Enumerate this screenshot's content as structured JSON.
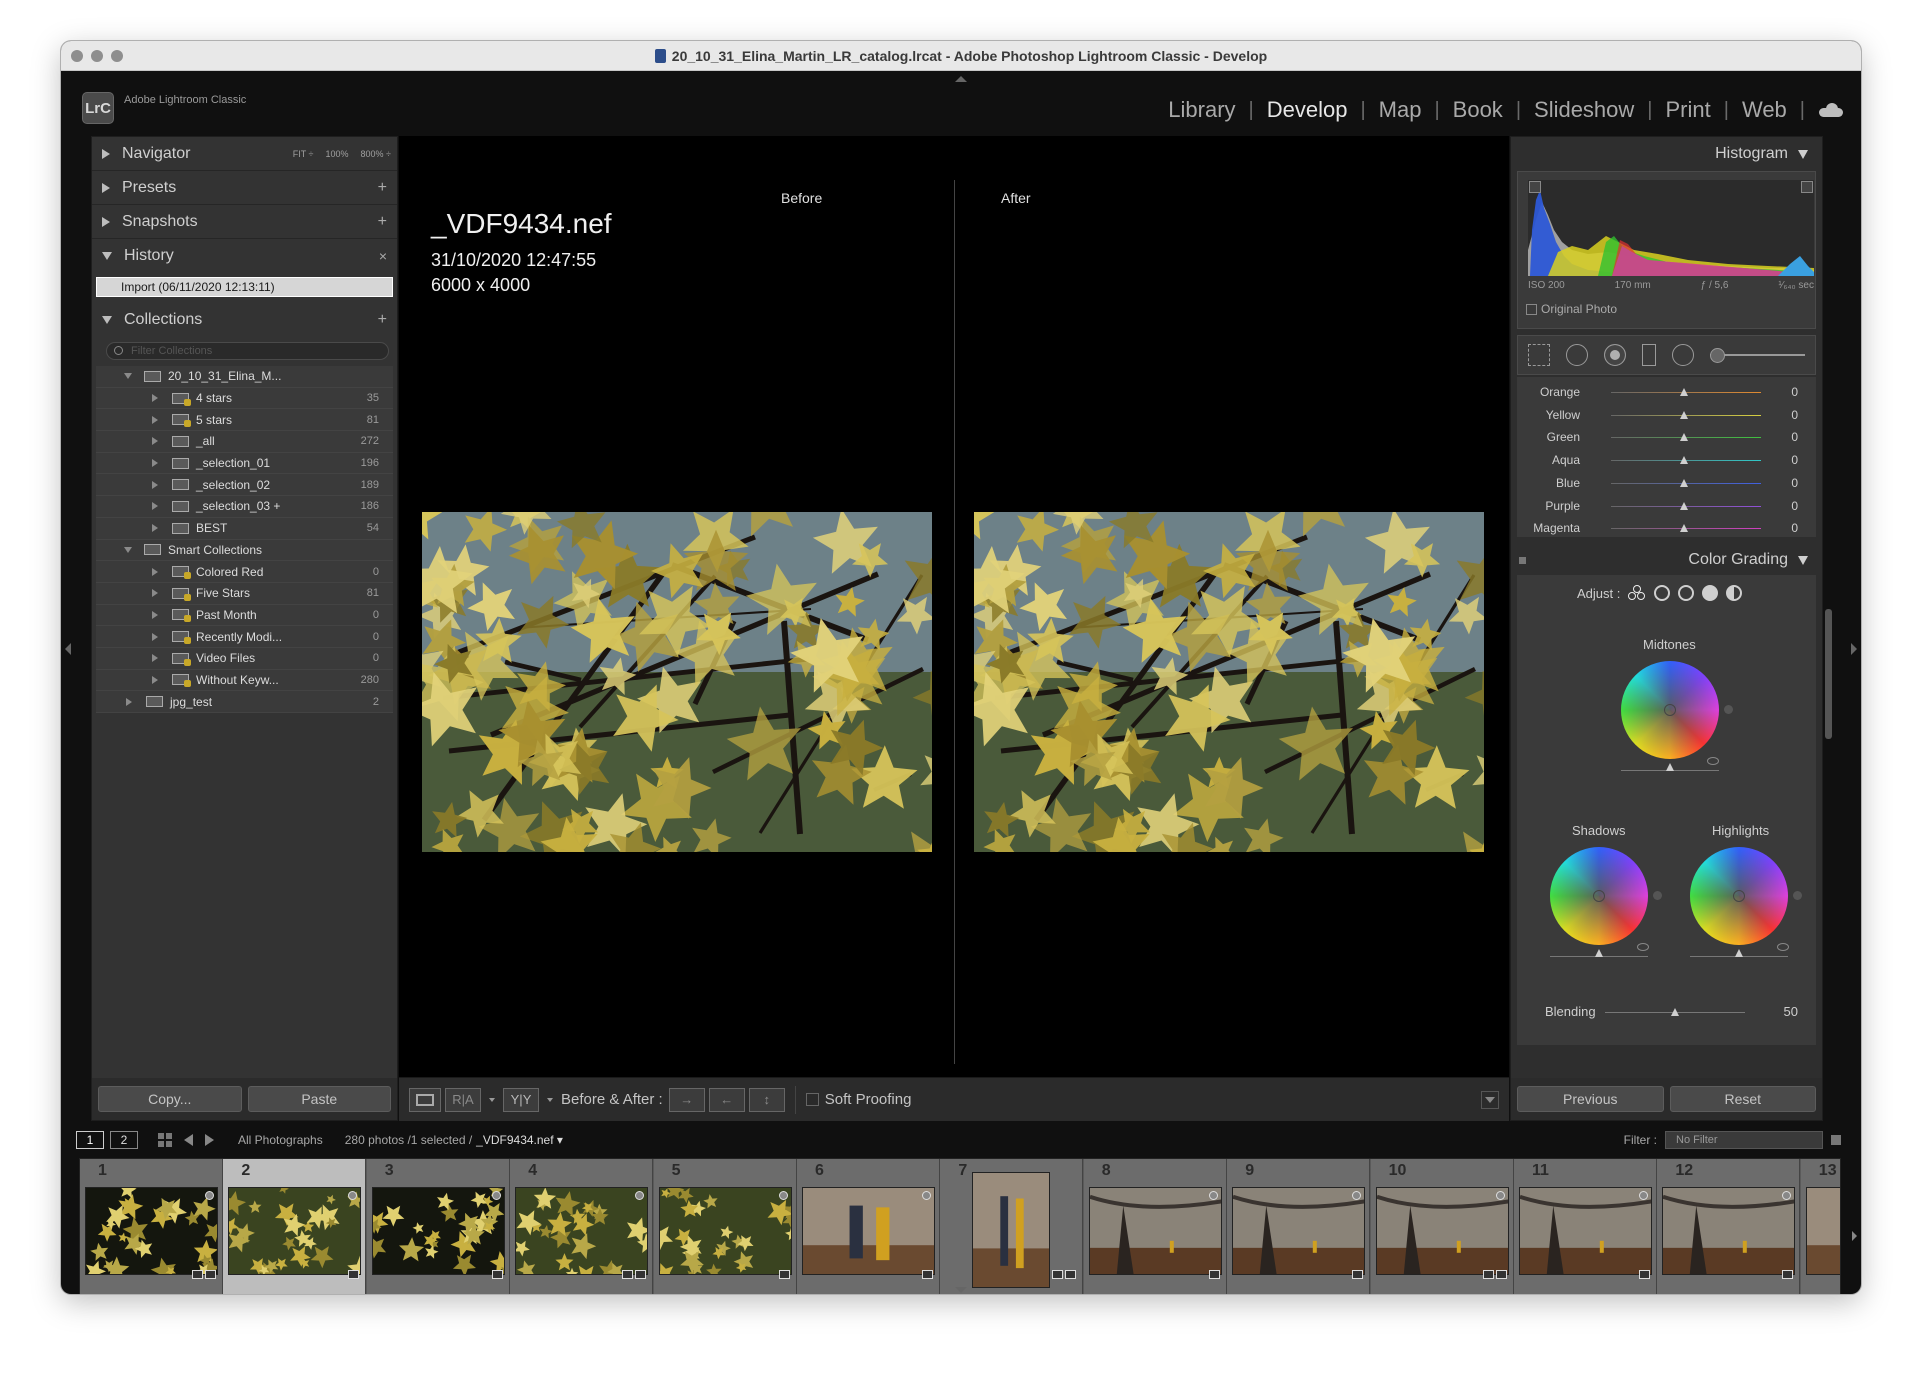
{
  "window": {
    "title": "20_10_31_Elina_Martin_LR_catalog.lrcat - Adobe Photoshop Lightroom Classic - Develop",
    "app_logo": "LrC",
    "app_name": "Adobe Lightroom Classic"
  },
  "modules": {
    "items": [
      "Library",
      "Develop",
      "Map",
      "Book",
      "Slideshow",
      "Print",
      "Web"
    ],
    "active": "Develop"
  },
  "left_panel": {
    "navigator": {
      "label": "Navigator",
      "zoom": [
        "FIT ÷",
        "100%",
        "800% ÷"
      ]
    },
    "presets": {
      "label": "Presets"
    },
    "snapshots": {
      "label": "Snapshots"
    },
    "history": {
      "label": "History",
      "items": [
        "Import (06/11/2020 12:13:11)"
      ]
    },
    "collections": {
      "label": "Collections",
      "filter_placeholder": "Filter Collections",
      "rows": [
        {
          "name": "20_10_31_Elina_M...",
          "count": "",
          "level": 1,
          "type": "set",
          "open": true
        },
        {
          "name": "4 stars",
          "count": "35",
          "level": 2,
          "type": "smart",
          "open": false
        },
        {
          "name": "5 stars",
          "count": "81",
          "level": 2,
          "type": "smart",
          "open": false
        },
        {
          "name": "_all",
          "count": "272",
          "level": 2,
          "type": "coll",
          "open": false
        },
        {
          "name": "_selection_01",
          "count": "196",
          "level": 2,
          "type": "coll",
          "open": false
        },
        {
          "name": "_selection_02",
          "count": "189",
          "level": 2,
          "type": "coll",
          "open": false
        },
        {
          "name": "_selection_03  +",
          "count": "186",
          "level": 2,
          "type": "coll",
          "open": false
        },
        {
          "name": "BEST",
          "count": "54",
          "level": 2,
          "type": "coll",
          "open": false
        },
        {
          "name": "Smart Collections",
          "count": "",
          "level": 1,
          "type": "set",
          "open": true
        },
        {
          "name": "Colored Red",
          "count": "0",
          "level": 2,
          "type": "smart",
          "open": false
        },
        {
          "name": "Five Stars",
          "count": "81",
          "level": 2,
          "type": "smart",
          "open": false
        },
        {
          "name": "Past Month",
          "count": "0",
          "level": 2,
          "type": "smart",
          "open": false
        },
        {
          "name": "Recently Modi...",
          "count": "0",
          "level": 2,
          "type": "smart",
          "open": false
        },
        {
          "name": "Video Files",
          "count": "0",
          "level": 2,
          "type": "smart",
          "open": false
        },
        {
          "name": "Without Keyw...",
          "count": "280",
          "level": 2,
          "type": "smart",
          "open": false
        },
        {
          "name": "jpg_test",
          "count": "2",
          "level": 0,
          "type": "set",
          "open": false
        }
      ]
    },
    "buttons": {
      "copy": "Copy...",
      "paste": "Paste"
    }
  },
  "center": {
    "before_label": "Before",
    "after_label": "After",
    "filename": "_VDF9434.nef",
    "datetime": "31/10/2020 12:47:55",
    "dimensions": "6000 x 4000"
  },
  "toolbar": {
    "before_after_label": "Before & After :",
    "soft_proofing": "Soft Proofing",
    "rr": "R|A",
    "yy": "Y|Y"
  },
  "right_panel": {
    "histogram": {
      "label": "Histogram",
      "iso": "ISO 200",
      "focal": "170 mm",
      "aperture": "ƒ / 5,6",
      "shutter": "¹⁄₆₄₀ sec",
      "original_photo": "Original Photo"
    },
    "hsl": [
      {
        "name": "Orange",
        "value": "0",
        "color": "#e08a30"
      },
      {
        "name": "Yellow",
        "value": "0",
        "color": "#d8d040"
      },
      {
        "name": "Green",
        "value": "0",
        "color": "#40c040"
      },
      {
        "name": "Aqua",
        "value": "0",
        "color": "#30c8c8"
      },
      {
        "name": "Blue",
        "value": "0",
        "color": "#4060e0"
      },
      {
        "name": "Purple",
        "value": "0",
        "color": "#9050d8"
      },
      {
        "name": "Magenta",
        "value": "0",
        "color": "#d040c0"
      }
    ],
    "color_grading": {
      "label": "Color Grading",
      "adjust": "Adjust :",
      "midtones": "Midtones",
      "shadows": "Shadows",
      "highlights": "Highlights",
      "blending_label": "Blending",
      "blending_value": "50"
    },
    "buttons": {
      "previous": "Previous",
      "reset": "Reset"
    }
  },
  "filmstrip_bar": {
    "page1": "1",
    "page2": "2",
    "source": "All Photographs",
    "count": "280 photos /1 selected /",
    "current": "_VDF9434.nef ▾",
    "filter_label": "Filter :",
    "filter_value": "No Filter"
  },
  "filmstrip": {
    "cells": [
      {
        "num": "1",
        "kind": "leaf-dark",
        "selected": false,
        "portrait": false
      },
      {
        "num": "2",
        "kind": "leaf",
        "selected": true,
        "portrait": false
      },
      {
        "num": "3",
        "kind": "leaf-dark",
        "selected": false,
        "portrait": false
      },
      {
        "num": "4",
        "kind": "leaf",
        "selected": false,
        "portrait": false
      },
      {
        "num": "5",
        "kind": "leaf",
        "selected": false,
        "portrait": false
      },
      {
        "num": "6",
        "kind": "couple",
        "selected": false,
        "portrait": false
      },
      {
        "num": "7",
        "kind": "couple",
        "selected": false,
        "portrait": true
      },
      {
        "num": "8",
        "kind": "tree",
        "selected": false,
        "portrait": false
      },
      {
        "num": "9",
        "kind": "tree",
        "selected": false,
        "portrait": false
      },
      {
        "num": "10",
        "kind": "tree",
        "selected": false,
        "portrait": false
      },
      {
        "num": "11",
        "kind": "tree",
        "selected": false,
        "portrait": false
      },
      {
        "num": "12",
        "kind": "tree",
        "selected": false,
        "portrait": false
      },
      {
        "num": "13",
        "kind": "couple",
        "selected": false,
        "portrait": false
      }
    ]
  }
}
